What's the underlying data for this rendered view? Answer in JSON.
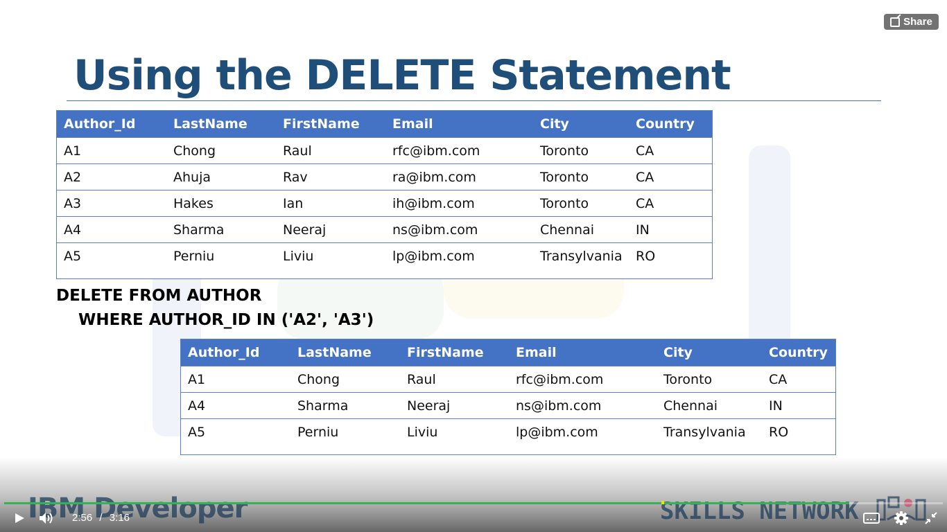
{
  "slide": {
    "title": "Using the DELETE Statement",
    "table_before": {
      "columns": [
        "Author_Id",
        "LastName",
        "FirstName",
        "Email",
        "City",
        "Country"
      ],
      "rows": [
        [
          "A1",
          "Chong",
          "Raul",
          "rfc@ibm.com",
          "Toronto",
          "CA"
        ],
        [
          "A2",
          "Ahuja",
          "Rav",
          "ra@ibm.com",
          "Toronto",
          "CA"
        ],
        [
          "A3",
          "Hakes",
          "Ian",
          "ih@ibm.com",
          "Toronto",
          "CA"
        ],
        [
          "A4",
          "Sharma",
          "Neeraj",
          "ns@ibm.com",
          "Chennai",
          "IN"
        ],
        [
          "A5",
          "Perniu",
          "Liviu",
          "lp@ibm.com",
          "Transylvania",
          "RO"
        ]
      ]
    },
    "sql": {
      "line1": "DELETE FROM AUTHOR",
      "line2": "WHERE AUTHOR_ID IN ('A2', 'A3')"
    },
    "table_after": {
      "columns": [
        "Author_Id",
        "LastName",
        "FirstName",
        "Email",
        "City",
        "Country"
      ],
      "rows": [
        [
          "A1",
          "Chong",
          "Raul",
          "rfc@ibm.com",
          "Toronto",
          "CA"
        ],
        [
          "A4",
          "Sharma",
          "Neeraj",
          "ns@ibm.com",
          "Chennai",
          "IN"
        ],
        [
          "A5",
          "Perniu",
          "Liviu",
          "lp@ibm.com",
          "Transylvania",
          "RO"
        ]
      ]
    },
    "brand_left": "IBM Developer",
    "brand_right": "SKILLS NETWORK"
  },
  "player": {
    "share_label": "Share",
    "current_time": "2:56",
    "separator": "/",
    "duration": "3:16",
    "progress_fraction": 0.9,
    "colors": {
      "progress": "#2db84d",
      "accent_header": "#4472c4",
      "title": "#1f4e79"
    },
    "icons": [
      "play-icon",
      "volume-icon",
      "share-icon",
      "captions-icon",
      "gear-icon",
      "exit-fullscreen-icon"
    ]
  }
}
